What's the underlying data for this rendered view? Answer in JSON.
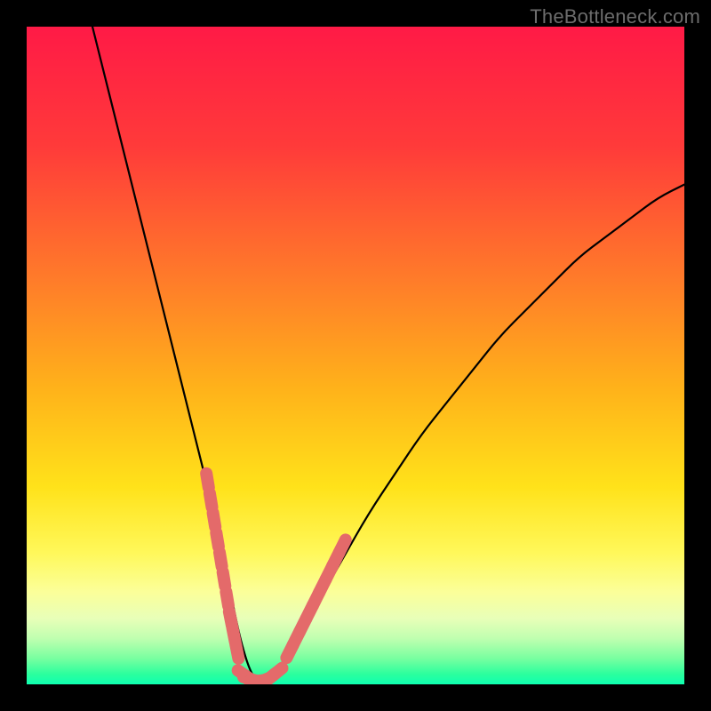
{
  "watermark": "TheBottleneck.com",
  "colors": {
    "frame": "#000000",
    "curve": "#000000",
    "dots": "#e46a6a",
    "gradient_stops": [
      {
        "offset": 0,
        "color": "#ff1a46"
      },
      {
        "offset": 0.18,
        "color": "#ff3a3a"
      },
      {
        "offset": 0.38,
        "color": "#ff7a2a"
      },
      {
        "offset": 0.55,
        "color": "#ffb21a"
      },
      {
        "offset": 0.7,
        "color": "#ffe21a"
      },
      {
        "offset": 0.8,
        "color": "#fff85a"
      },
      {
        "offset": 0.86,
        "color": "#fbff9a"
      },
      {
        "offset": 0.9,
        "color": "#e8ffb8"
      },
      {
        "offset": 0.93,
        "color": "#c0ffb0"
      },
      {
        "offset": 0.96,
        "color": "#7affa0"
      },
      {
        "offset": 0.985,
        "color": "#2aff9e"
      },
      {
        "offset": 1.0,
        "color": "#0fffb0"
      }
    ]
  },
  "chart_data": {
    "type": "line",
    "title": "",
    "xlabel": "",
    "ylabel": "",
    "xlim": [
      0,
      100
    ],
    "ylim": [
      0,
      100
    ],
    "grid": false,
    "legend": false,
    "series": [
      {
        "name": "bottleneck-curve",
        "x": [
          10,
          12,
          14,
          16,
          18,
          20,
          22,
          24,
          26,
          28,
          30,
          31,
          32,
          33,
          34,
          35,
          36,
          38,
          40,
          44,
          48,
          52,
          56,
          60,
          64,
          68,
          72,
          76,
          80,
          84,
          88,
          92,
          96,
          100
        ],
        "y": [
          100,
          92,
          84,
          76,
          68,
          60,
          52,
          44,
          36,
          28,
          20,
          14,
          9,
          5,
          2,
          0.5,
          0.5,
          2,
          5,
          12,
          19,
          26,
          32,
          38,
          43,
          48,
          53,
          57,
          61,
          65,
          68,
          71,
          74,
          76
        ]
      }
    ],
    "markers": [
      {
        "name": "left-cluster",
        "x": [
          27.5,
          28,
          28.5,
          29,
          29.5,
          30,
          30.5,
          31,
          31.5,
          32
        ],
        "y": [
          31,
          28,
          25,
          22,
          19,
          16,
          13,
          10,
          7.5,
          5
        ]
      },
      {
        "name": "trough",
        "x": [
          33,
          34,
          35,
          36,
          37,
          38
        ],
        "y": [
          1.5,
          0.8,
          0.5,
          0.6,
          1.0,
          1.8
        ]
      },
      {
        "name": "right-cluster",
        "x": [
          40,
          41,
          42,
          43,
          44,
          45,
          46,
          47,
          48
        ],
        "y": [
          5,
          7,
          9,
          11,
          13,
          15,
          17,
          19,
          21
        ]
      }
    ]
  }
}
